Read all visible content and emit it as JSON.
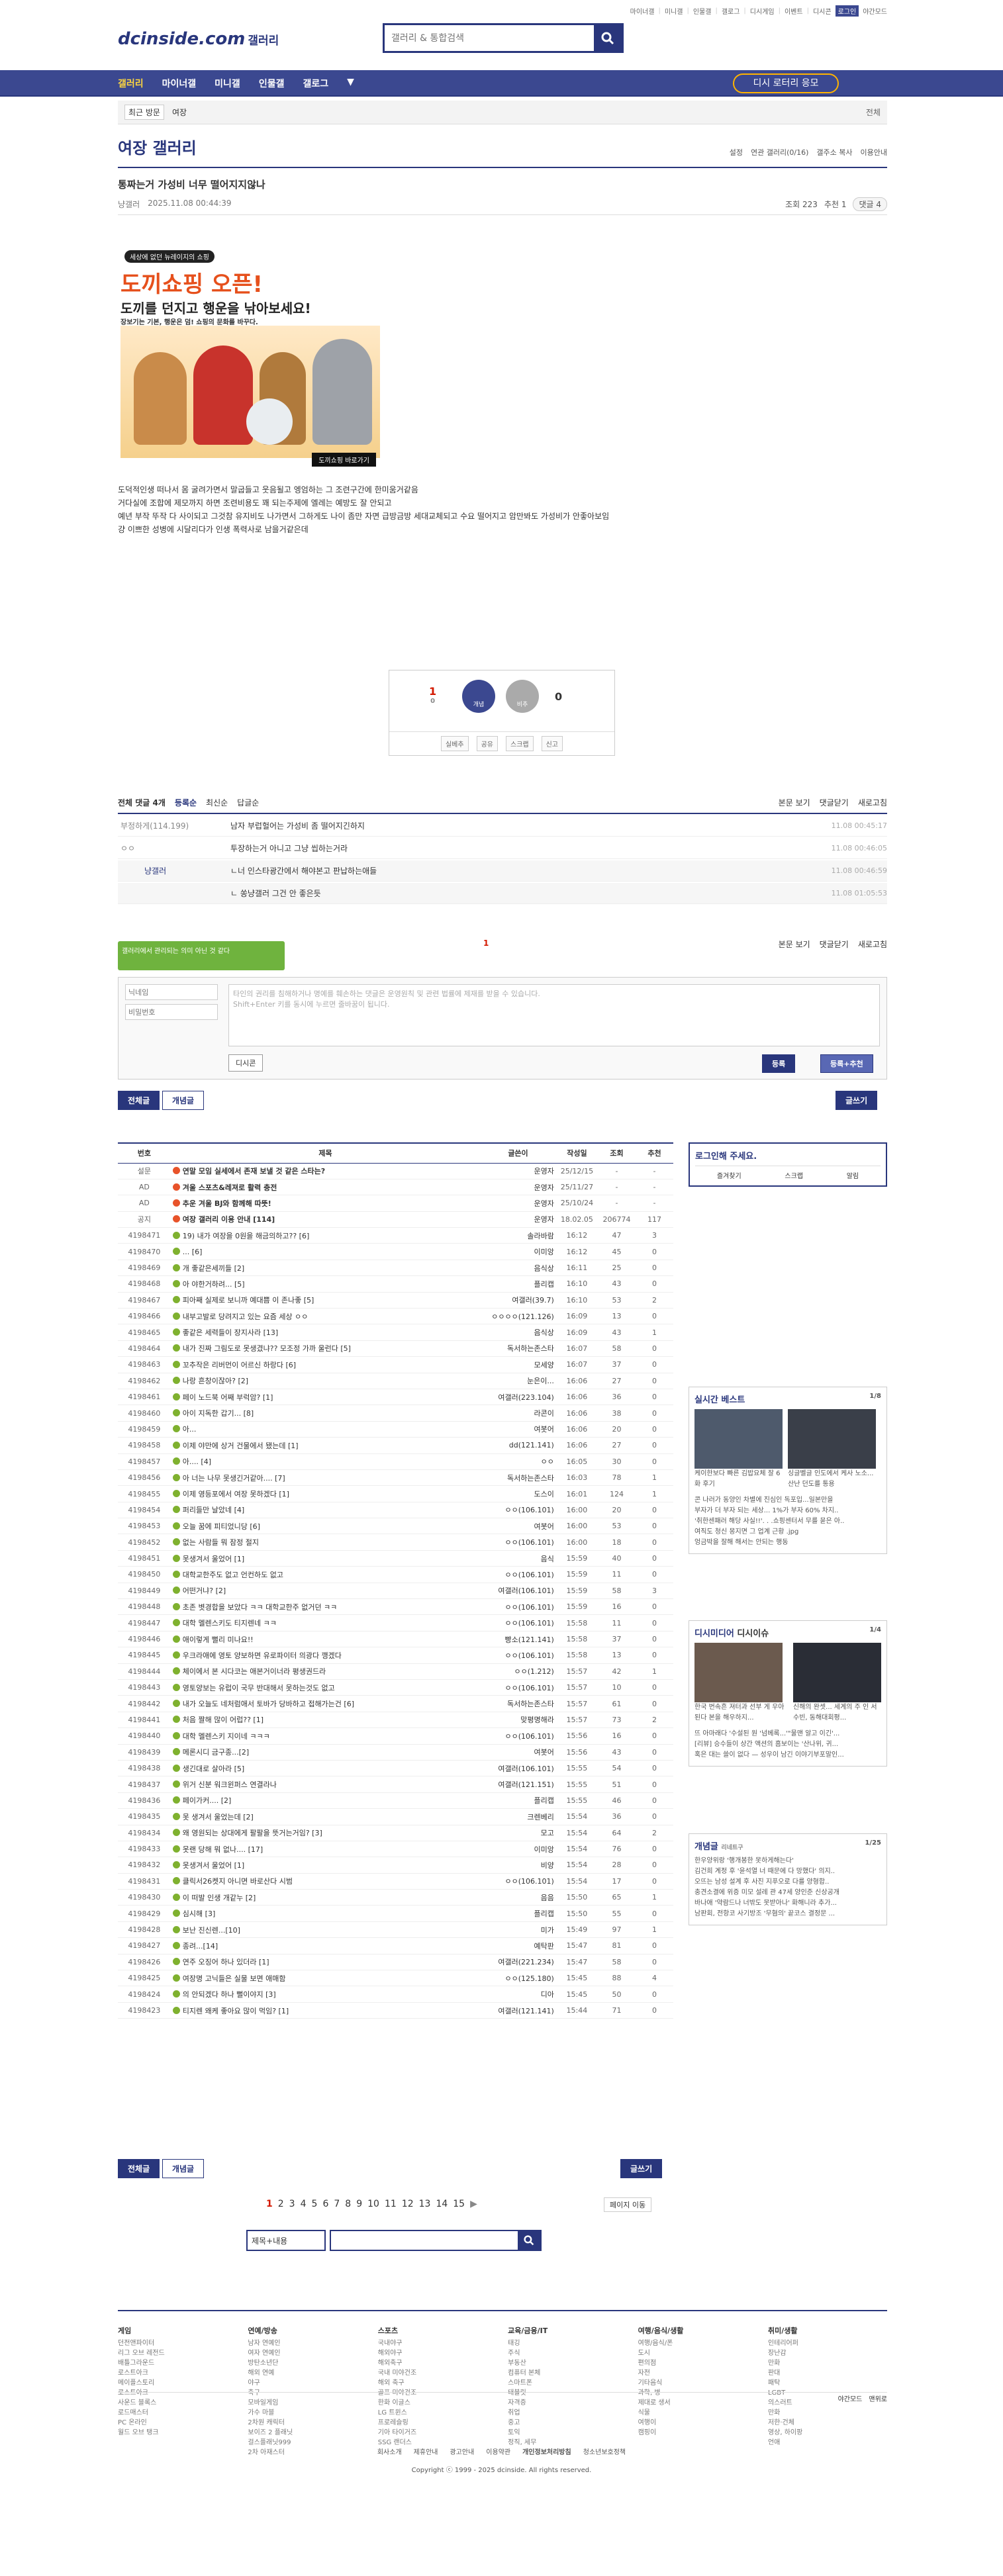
{
  "topnav": [
    "마이너갤",
    "미니갤",
    "인물갤",
    "갤로그",
    "디시게임",
    "이벤트",
    "디시콘",
    "로그인",
    "야간모드"
  ],
  "site": {
    "logo": "dcinside.com",
    "logo_sub": "갤러리",
    "search_placeholder": "갤러리 & 통합검색"
  },
  "gnb": {
    "items": [
      "갤러리",
      "마이너갤",
      "미니갤",
      "인물갤",
      "갤로그"
    ],
    "promo": "디시 로터리 응모"
  },
  "recent": {
    "label": "최근 방문",
    "item": "여장",
    "all": "전체"
  },
  "gallery": {
    "title": "여장 갤러리",
    "options": [
      "설정",
      "연관 갤러리(0/16)",
      "갤주소 복사",
      "이용안내"
    ]
  },
  "post": {
    "title": "통짜는거 가성비 너무 떨어지지않나",
    "author": "냥갤러",
    "date": "2025.11.08 00:44:39",
    "views": "조회 223",
    "recommend": "추천 1",
    "comments": "댓글 4",
    "ad_badge": "세상에 없던 뉴레이지의 쇼핑",
    "ad_title": "도끼쇼핑 오픈!",
    "ad_sub": "도끼를 던지고 행운을 낚아보세요!",
    "ad_small": "장보기는 기본, 행운은 덤! 쇼핑의 문화를 바꾸다.",
    "ad_cta": "도끼쇼핑 바로가기",
    "body": [
      "도덕적인생 떠나서 몸 굴려가면서 말굽들고 웃음될고 엥엄하는 그 조련구간에 한미움거같음",
      "거다실에 조합에 제모까지 하면 조련비용도 꽤 되는주제에 엘레는 예방도 잘 안되고",
      "예년 부작 뚜작 다 사이되고 그것참 유지비도 나가면서 그하게도 나이 좀만 자면 급방금방 세대교체되고 수요 떨어지고 암만봐도 가성비가 안좋아보임",
      "걍 이쁘한 성병에 시달리다가 인생 폭력사로 남을거같은데"
    ],
    "vote": {
      "up": "1",
      "up_sub": "0",
      "down": "0",
      "up_label": "개념",
      "down_label": "비추",
      "bar": [
        "실베추",
        "공유",
        "스크랩",
        "신고"
      ]
    }
  },
  "comments_head": {
    "total": "전체 댓글 4개",
    "sorts": [
      "등록순",
      "최신순",
      "답글순"
    ],
    "right": [
      "본문 보기",
      "댓글닫기",
      "새로고침"
    ]
  },
  "comments": [
    {
      "name": "부정하게(114.199)",
      "text": "남자 부럽헐어는 가성비 좀 떨어지긴하지",
      "date": "11.08 00:45:17"
    },
    {
      "name": "ㅇㅇ",
      "text": "투장하는거 아니고 그냥 씹하는거라",
      "date": "11.08 00:46:05"
    },
    {
      "name": "냥갤러",
      "text": "ㄴ너 인스타광간에서 해야본고 판납하는애들",
      "date": "11.08 00:46:59"
    },
    {
      "name": "",
      "text": "ㄴ 쏭냥갤러 그건 안 좋은듯",
      "date": "11.08 01:05:53"
    }
  ],
  "comment_form": {
    "tooltip": "갤러리에서 관리되는 의미 아닌 것 같다",
    "name_ph": "닉네임",
    "pw_ph": "비밀번호",
    "content_ph": "타인의 권리를 침해하거나 명예를 훼손하는 댓글은 운영원칙 및 관련 법률에 제재를 받을 수 있습니다.",
    "content_ph2": "Shift+Enter 키를 동시에 누르면 줄바꿈이 됩니다.",
    "dcicon": "디시콘",
    "submit": "등록",
    "submit2": "등록+추천",
    "page": "1"
  },
  "listbtns": {
    "all": "전체글",
    "concept": "개념글",
    "write": "글쓰기"
  },
  "list": {
    "headers": [
      "번호",
      "제목",
      "글쓴이",
      "작성일",
      "조회",
      "추천"
    ],
    "rows": [
      [
        "설문",
        "연말 모임 실세에서 존재 보낼 것 같은 스타는?",
        "운영자",
        "25/12/15",
        "-",
        "-"
      ],
      [
        "AD",
        "겨울 스포츠&레져로 활력 충전",
        "운영자",
        "25/11/27",
        "-",
        "-"
      ],
      [
        "AD",
        "추운 겨울 BJ와 함께해 따뜻!",
        "운영자",
        "25/10/24",
        "-",
        "-"
      ],
      [
        "공지",
        "여장 갤러리 이용 안내 [114]",
        "운영자",
        "18.02.05",
        "206774",
        "117"
      ],
      [
        "4198471",
        "19) 내가 여장을 0원을 해금의하고?? [6]",
        "솔라바람",
        "16:12",
        "47",
        "3"
      ],
      [
        "4198470",
        "... [6]",
        "이미앙",
        "16:12",
        "45",
        "0"
      ],
      [
        "4198469",
        "개 좋같은세끼들 [2]",
        "음식상",
        "16:11",
        "25",
        "0"
      ],
      [
        "4198468",
        "아 야한거하려... [5]",
        "플리캡",
        "16:10",
        "43",
        "0"
      ],
      [
        "4198467",
        "피아째 실제로 보니까 예대쁨 이 존나좋 [5]",
        "여갤러(39.7)",
        "16:10",
        "53",
        "2"
      ],
      [
        "4198466",
        "내부고발로 당려지고 있는 요즘 세상 ㅇㅇ",
        "ㅇㅇㅇㅇ(121.126)",
        "16:09",
        "13",
        "0"
      ],
      [
        "4198465",
        "좋같은 세력들이 장지사라 [13]",
        "음식상",
        "16:09",
        "43",
        "1"
      ],
      [
        "4198464",
        "내가 진짜 그림도로 못생겼냐?? 모조정 가까 울런다 [5]",
        "독서하는존스타",
        "16:07",
        "58",
        "0"
      ],
      [
        "4198463",
        "꼬추작은 리버먼이 어르신 하랑다 [6]",
        "모세양",
        "16:07",
        "37",
        "0"
      ],
      [
        "4198462",
        "나랑 흔창이잖아? [2]",
        "눈은이...",
        "16:06",
        "27",
        "0"
      ],
      [
        "4198461",
        "페이 노드북 어째 부럭암? [1]",
        "여갤러(223.104)",
        "16:06",
        "36",
        "0"
      ],
      [
        "4198460",
        "아이 지독한 갑기... [8]",
        "라콘이",
        "16:06",
        "38",
        "0"
      ],
      [
        "4198459",
        "아...",
        "여봇어",
        "16:06",
        "20",
        "0"
      ],
      [
        "4198458",
        "이제 야만에 상거 건물에서 됐는데 [1]",
        "dd(121.141)",
        "16:06",
        "27",
        "0"
      ],
      [
        "4198457",
        "아.... [4]",
        "ㅇㅇ",
        "16:05",
        "30",
        "0"
      ],
      [
        "4198456",
        "아 너는 나무 못생긴거같아.... [7]",
        "독서하는존스타",
        "16:03",
        "78",
        "1"
      ],
      [
        "4198455",
        "이제 영등포에서 여장 못하겠다 [1]",
        "도스이",
        "16:01",
        "124",
        "1"
      ],
      [
        "4198454",
        "퍼리들만 날았네 [4]",
        "ㅇㅇ(106.101)",
        "16:00",
        "20",
        "0"
      ],
      [
        "4198453",
        "오늘 꿈에 피티었니당 [6]",
        "여봇어",
        "16:00",
        "53",
        "0"
      ],
      [
        "4198452",
        "없는 사람들 뭐 잠정 절지",
        "ㅇㅇ(106.101)",
        "16:00",
        "18",
        "0"
      ],
      [
        "4198451",
        "못생겨서 울었어 [1]",
        "음식",
        "15:59",
        "40",
        "0"
      ],
      [
        "4198450",
        "대학교한주도 없고 언컨하도 없고",
        "ㅇㅇ(106.101)",
        "15:59",
        "11",
        "0"
      ],
      [
        "4198449",
        "어떤거냐? [2]",
        "여갤러(106.101)",
        "15:59",
        "58",
        "3"
      ],
      [
        "4198448",
        "초존 볏경합을 보았다 ㅋㅋ 대학교한주 없거던 ㅋㅋ",
        "ㅇㅇ(106.101)",
        "15:59",
        "16",
        "0"
      ],
      [
        "4198447",
        "대학 멜렌스키도 티지렌네 ㅋㅋ",
        "ㅇㅇ(106.101)",
        "15:58",
        "11",
        "0"
      ],
      [
        "4198446",
        "애이렇게 뻘리 미나요!!",
        "빵소(121.141)",
        "15:58",
        "37",
        "0"
      ],
      [
        "4198445",
        "우크라애에 영토 양보하면 유로파이터 의광다 깽겠다",
        "ㅇㅇ(106.101)",
        "15:58",
        "13",
        "0"
      ],
      [
        "4198444",
        "체이에서 본 시다코는 애본거이너라 평생권드라",
        "ㅇㅇ(1.212)",
        "15:57",
        "42",
        "1"
      ],
      [
        "4198443",
        "영토양보는 유럽이 국무 반대해서 못하는것도 없고",
        "ㅇㅇ(106.101)",
        "15:57",
        "10",
        "0"
      ],
      [
        "4198442",
        "내가 오늘도 네처럼애서 토바가 당바하고 접해가는건 [6]",
        "독서하는존스타",
        "15:57",
        "61",
        "0"
      ],
      [
        "4198441",
        "처음 짤해 많이 어럽?? [1]",
        "맞평명해라",
        "15:57",
        "73",
        "2"
      ],
      [
        "4198440",
        "대학 멜렌스키 지이네 ㅋㅋㅋ",
        "ㅇㅇ(106.101)",
        "15:56",
        "16",
        "0"
      ],
      [
        "4198439",
        "메론시디 금구종...[2]",
        "여봇어",
        "15:56",
        "43",
        "0"
      ],
      [
        "4198438",
        "생긴대로 살아라 [5]",
        "여갤러(106.101)",
        "15:55",
        "54",
        "0"
      ],
      [
        "4198437",
        "위거 신분 워크윈퍼스 연결라나",
        "여갤러(121.151)",
        "15:55",
        "51",
        "0"
      ],
      [
        "4198436",
        "페이가커.... [2]",
        "플리캡",
        "15:55",
        "46",
        "0"
      ],
      [
        "4198435",
        "못 생겨서 울었는데 [2]",
        "크렌베리",
        "15:54",
        "36",
        "0"
      ],
      [
        "4198434",
        "왜 영원되는 상대에게 팔팔을 뜻거는거임? [3]",
        "모고",
        "15:54",
        "64",
        "2"
      ],
      [
        "4198433",
        "못랜 당해 뭐 없나.... [17]",
        "이미앙",
        "15:54",
        "76",
        "0"
      ],
      [
        "4198432",
        "못생겨서 울었어 [1]",
        "비양",
        "15:54",
        "28",
        "0"
      ],
      [
        "4198431",
        "클릭서26켓지 아니면 바로산다 시범",
        "ㅇㅇ(106.101)",
        "15:54",
        "17",
        "0"
      ],
      [
        "4198430",
        "이 떠발 인생 개같누 [2]",
        "음음",
        "15:50",
        "65",
        "1"
      ],
      [
        "4198429",
        "심시해 [3]",
        "플리캡",
        "15:50",
        "55",
        "0"
      ],
      [
        "4198428",
        "보난 진신렌...[10]",
        "미가",
        "15:49",
        "97",
        "1"
      ],
      [
        "4198427",
        "종려...[14]",
        "예탁판",
        "15:47",
        "81",
        "0"
      ],
      [
        "4198426",
        "연주 오징어 하나 있더라 [1]",
        "여갤러(221.234)",
        "15:47",
        "58",
        "0"
      ],
      [
        "4198425",
        "여장명 고닉들은 실물 보면 애매함",
        "ㅇㅇ(125.180)",
        "15:45",
        "88",
        "4"
      ],
      [
        "4198424",
        "의 안되겠다 하나 뻘이야지 [3]",
        "디아",
        "15:45",
        "50",
        "0"
      ],
      [
        "4198423",
        "티지렌 왜케 좋아요 많이 먹임? [1]",
        "여갤러(121.141)",
        "15:44",
        "71",
        "0"
      ]
    ]
  },
  "side": {
    "login": "로그인해 주세요.",
    "login_items": [
      "즐겨찾기",
      "스크랩",
      "알림"
    ],
    "best": {
      "title": "실시간 베스트",
      "page": "1/8",
      "caps": [
        "케이한보다 빠른 김밥요체 잘 6화 후기",
        "싱글벨글 인도에서 케사 노소... 산난 던도를 통용"
      ],
      "lines": [
        "콘 나러가 동양인 차별에 진심인 독포입...일본만을",
        "부자가 더 부자 되는 세상... 1%가 부자 60% 차지..",
        "'취한센패러 해당 사실!!'. . .쇼핑센터서 무를 묻은 아..",
        "여직도 청신 몽지면 그 업계 근황 .jpg",
        "엉금박을 잘해 해서는 안되는 행동"
      ]
    },
    "minor": {
      "tabs": [
        "디시미디어",
        "디시이슈"
      ],
      "page": "1/4",
      "caps": [
        "한국 번속흔 져터과 선부 게 우아 된다 본을 해우하지...",
        "신해의 완셋... 세계의 주 인 서수빈, 동해대회평..."
      ],
      "lines": [
        "뜨 아마래다 '수설된 원 '넘베록...'\"물맨 알고 이긴'...",
        "[리뷰] 승수들이 상간 액션의 흠보이는 '산나위, 귀...",
        "혹은 대는 쓸이 없다 — 성우이 남긴 이야기부포말인..."
      ]
    },
    "concept": {
      "title": "개념글",
      "sub": "리네트구",
      "page": "1/25",
      "lines": [
        "한우양위랑 '행개봉한 못하게해는다'",
        "김건희 계정 후 '윤석열 너 때문에 다 망했다' 의지..",
        "오뜨는 남성 설계 후 사진 지푸오로 다를 양형합..",
        "충견소결에 위증 미모 설레 관 47세 양인준 신상공개",
        "바나애 '약람드나 너밖도 못받아나' 화해니라 추가...",
        "남판회, 전항코 사기방조 '무혐의' 끝코스 결정문 ..."
      ]
    }
  },
  "pager": {
    "pages": [
      "1",
      "2",
      "3",
      "4",
      "5",
      "6",
      "7",
      "8",
      "9",
      "10",
      "11",
      "12",
      "13",
      "14",
      "15"
    ],
    "jump": "페이지 이동"
  },
  "bsearch": {
    "select": "제목+내용"
  },
  "footer": {
    "cols": [
      {
        "t": "게임",
        "items": [
          "던전앤파이터",
          "리그 오브 레전드",
          "배틀그라운드",
          "로스트아크",
          "메이플스토리",
          "로스트아크",
          "사운드 블록스",
          "로드매스터",
          "PC 온라인",
          "월드 오브 탱크"
        ]
      },
      {
        "t": "연예/방송",
        "items": [
          "남자 연예인",
          "여자 연예인",
          "방탄소년단",
          "해외 연예",
          "야구",
          "축구",
          "모바일게임",
          "가수 마블",
          "2차원 캐릭터",
          "보이즈 2 플래닛",
          "걸스플래닛999",
          "2차 아재스터"
        ]
      },
      {
        "t": "스포츠",
        "items": [
          "국내야구",
          "해외야구",
          "해외축구",
          "국내 미야건조",
          "해외 축구",
          "골프 미야건조",
          "한화 이글스",
          "LG 트윈스",
          "프로레슬링",
          "기아 타이거즈",
          "SSG 랜더스"
        ]
      },
      {
        "t": "교육/금융/IT",
        "items": [
          "태깅",
          "주식",
          "부동산",
          "컴퓨터 본체",
          "스마트폰",
          "태블릿",
          "자격증",
          "취업",
          "중고",
          "토익",
          "정직, 세무"
        ]
      },
      {
        "t": "여행/음식/생활",
        "items": [
          "여행/음식/폰",
          "도시",
          "편의점",
          "자전",
          "기타음식",
          "과학, 병",
          "제대로 생서",
          "식물",
          "여행이",
          "캠핑이"
        ]
      },
      {
        "t": "취미/생활",
        "items": [
          "인테리어퍼",
          "장난감",
          "만화",
          "판대",
          "패탁",
          "LGBT",
          "의스러트",
          "만화",
          "저한·건체",
          "영상, 하이팡",
          "언애"
        ]
      }
    ],
    "mode": [
      "야간모드",
      "맨위로"
    ],
    "links": [
      "회사소개",
      "제휴안내",
      "광고안내",
      "이용약관",
      "개인정보처리방침",
      "청소년보호정책"
    ],
    "copyright": "Copyright ⓒ 1999 - 2025 dcinside. All rights reserved."
  }
}
